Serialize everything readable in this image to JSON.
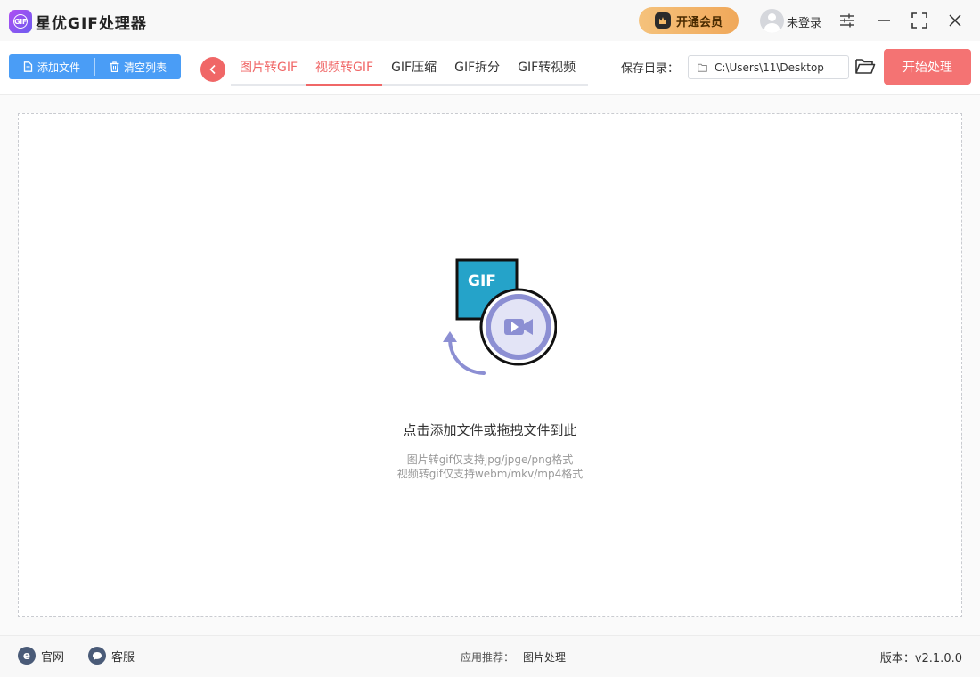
{
  "app": {
    "title": "星优GIF处理器",
    "logo_text": "GIF"
  },
  "header": {
    "vip_label": "开通会员",
    "login_label": "未登录"
  },
  "toolbar": {
    "add_file_label": "添加文件",
    "clear_list_label": "清空列表",
    "tabs": [
      {
        "label": "图片转GIF",
        "active": false
      },
      {
        "label": "视频转GIF",
        "active": true
      },
      {
        "label": "GIF压缩",
        "active": false
      },
      {
        "label": "GIF拆分",
        "active": false
      },
      {
        "label": "GIF转视频",
        "active": false
      }
    ],
    "save_dir_label": "保存目录：",
    "save_dir_value": "C:\\Users\\11\\Desktop",
    "start_label": "开始处理"
  },
  "drop_zone": {
    "illustration_text": "GIF",
    "title": "点击添加文件或拖拽文件到此",
    "hint_image": "图片转gif仅支持jpg/jpge/png格式",
    "hint_video": "视频转gif仅支持webm/mkv/mp4格式"
  },
  "footer": {
    "site_icon_text": "e",
    "site_label": "官网",
    "service_label": "客服",
    "recommend_label": "应用推荐：",
    "recommend_link": "图片处理",
    "version": "版本：v2.1.0.0"
  },
  "colors": {
    "accent": "#f06767",
    "primary_button": "#4a9df6",
    "start_button": "#f47373",
    "vip_gold": "#f0a85a",
    "gif_card": "#25a3c9",
    "video_circle": "#8c8fd3"
  }
}
